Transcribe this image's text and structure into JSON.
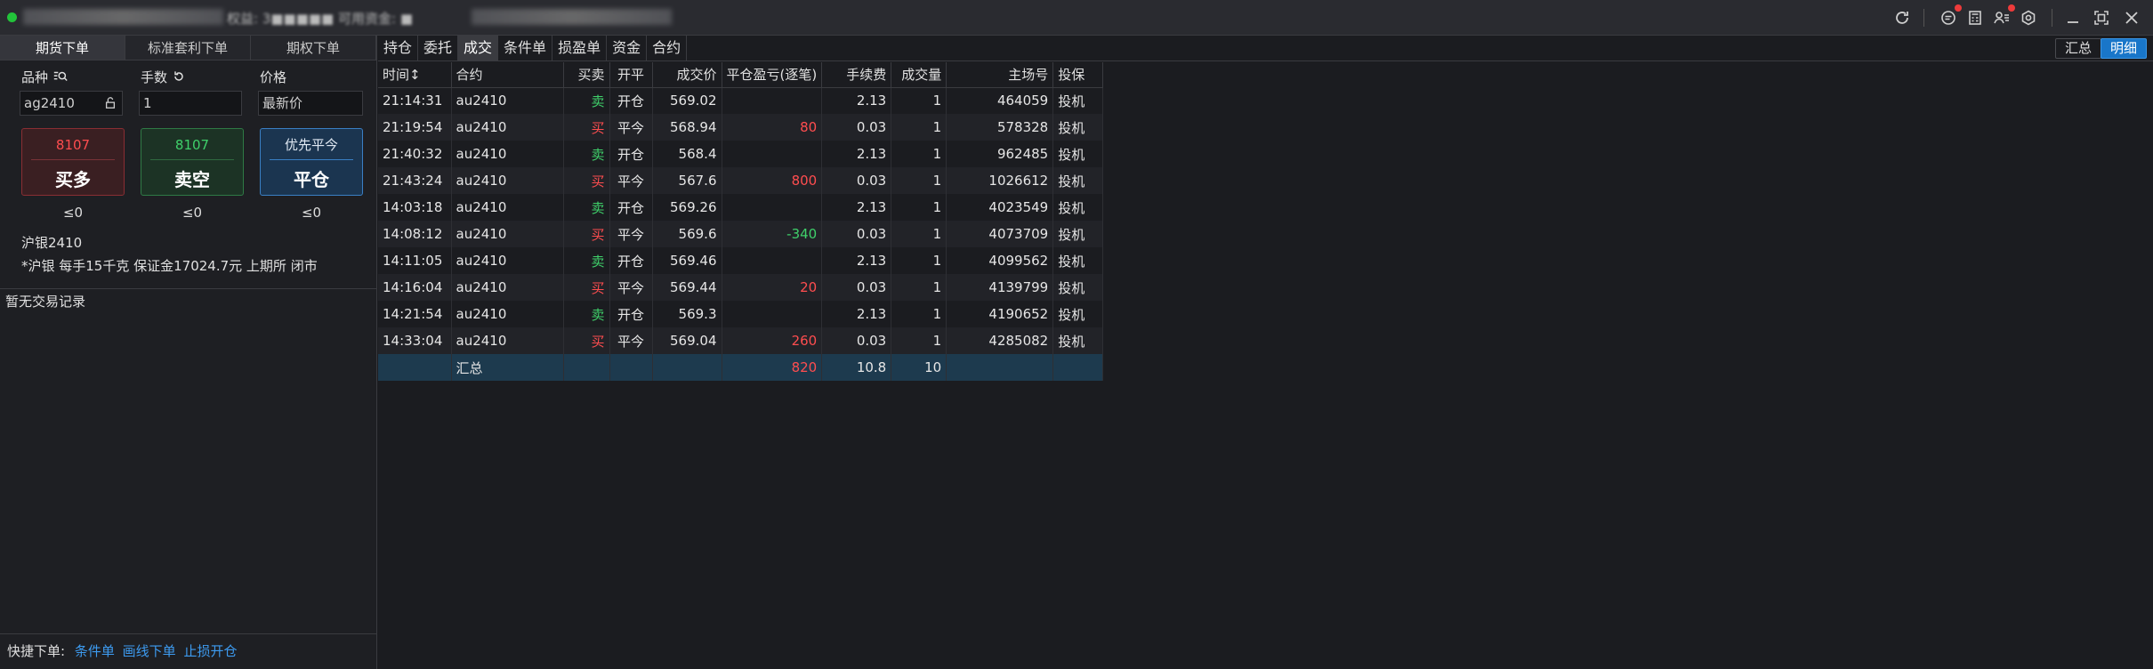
{
  "window": {
    "title_blurred": "权益: 3■■■■■  可用资金: ■"
  },
  "left": {
    "tabs": [
      "期货下单",
      "标准套利下单",
      "期权下单"
    ],
    "labels": {
      "variety": "品种",
      "lots": "手数",
      "price": "价格"
    },
    "inputs": {
      "contract": "ag2410",
      "lots": "1",
      "price": "最新价"
    },
    "buttons": {
      "buy": {
        "price": "8107",
        "label": "买多"
      },
      "sell": {
        "price": "8107",
        "label": "卖空"
      },
      "close": {
        "price": "优先平今",
        "label": "平仓"
      }
    },
    "limits": [
      "≤0",
      "≤0",
      "≤0"
    ],
    "info_line1": "沪银2410",
    "info_line2": "*沪银 每手15千克 保证金17024.7元 上期所 闭市",
    "no_record": "暂无交易记录",
    "quick_label": "快捷下单:",
    "quick_links": [
      "条件单",
      "画线下单",
      "止损开仓"
    ]
  },
  "right": {
    "tabs": [
      "持仓",
      "委托",
      "成交",
      "条件单",
      "损盈单",
      "资金",
      "合约"
    ],
    "active_tab": "成交",
    "view_toggle": {
      "summary": "汇总",
      "detail": "明细"
    },
    "columns": [
      "时间↕",
      "合约",
      "买卖",
      "开平",
      "成交价",
      "平仓盈亏(逐笔)",
      "手续费",
      "成交量",
      "主场号",
      "投保"
    ],
    "rows": [
      {
        "time": "21:14:31",
        "contract": "au2410",
        "side": "卖",
        "oc": "开仓",
        "price": "569.02",
        "pnl": "",
        "fee": "2.13",
        "qty": "1",
        "id": "464059",
        "hedge": "投机"
      },
      {
        "time": "21:19:54",
        "contract": "au2410",
        "side": "买",
        "oc": "平今",
        "price": "568.94",
        "pnl": "80",
        "fee": "0.03",
        "qty": "1",
        "id": "578328",
        "hedge": "投机"
      },
      {
        "time": "21:40:32",
        "contract": "au2410",
        "side": "卖",
        "oc": "开仓",
        "price": "568.4",
        "pnl": "",
        "fee": "2.13",
        "qty": "1",
        "id": "962485",
        "hedge": "投机"
      },
      {
        "time": "21:43:24",
        "contract": "au2410",
        "side": "买",
        "oc": "平今",
        "price": "567.6",
        "pnl": "800",
        "fee": "0.03",
        "qty": "1",
        "id": "1026612",
        "hedge": "投机"
      },
      {
        "time": "14:03:18",
        "contract": "au2410",
        "side": "卖",
        "oc": "开仓",
        "price": "569.26",
        "pnl": "",
        "fee": "2.13",
        "qty": "1",
        "id": "4023549",
        "hedge": "投机"
      },
      {
        "time": "14:08:12",
        "contract": "au2410",
        "side": "买",
        "oc": "平今",
        "price": "569.6",
        "pnl": "-340",
        "fee": "0.03",
        "qty": "1",
        "id": "4073709",
        "hedge": "投机"
      },
      {
        "time": "14:11:05",
        "contract": "au2410",
        "side": "卖",
        "oc": "开仓",
        "price": "569.46",
        "pnl": "",
        "fee": "2.13",
        "qty": "1",
        "id": "4099562",
        "hedge": "投机"
      },
      {
        "time": "14:16:04",
        "contract": "au2410",
        "side": "买",
        "oc": "平今",
        "price": "569.44",
        "pnl": "20",
        "fee": "0.03",
        "qty": "1",
        "id": "4139799",
        "hedge": "投机"
      },
      {
        "time": "14:21:54",
        "contract": "au2410",
        "side": "卖",
        "oc": "开仓",
        "price": "569.3",
        "pnl": "",
        "fee": "2.13",
        "qty": "1",
        "id": "4190652",
        "hedge": "投机"
      },
      {
        "time": "14:33:04",
        "contract": "au2410",
        "side": "买",
        "oc": "平今",
        "price": "569.04",
        "pnl": "260",
        "fee": "0.03",
        "qty": "1",
        "id": "4285082",
        "hedge": "投机"
      }
    ],
    "summary": {
      "label": "汇总",
      "pnl": "820",
      "fee": "10.8",
      "qty": "10"
    }
  },
  "icons": [
    "refresh-icon",
    "message-icon",
    "calculator-icon",
    "user-list-icon",
    "settings-icon",
    "minimize-icon",
    "maximize-icon",
    "close-icon"
  ],
  "colors": {
    "buy": "#ff4d4f",
    "sell": "#3fd06a",
    "accent": "#1976c9"
  }
}
